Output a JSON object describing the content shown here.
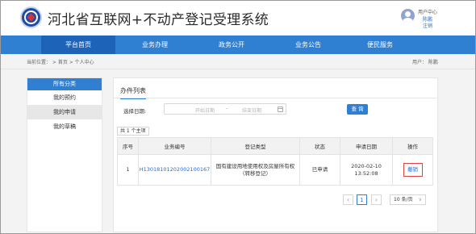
{
  "header": {
    "site_title": "河北省互联网+不动产登记受理系统",
    "user_center": "用户中心",
    "user_name": "陈鹏",
    "logout": "注销"
  },
  "nav": {
    "items": [
      {
        "label": "平台首页",
        "active": true
      },
      {
        "label": "业务办理"
      },
      {
        "label": "政务公开"
      },
      {
        "label": "业务公告"
      },
      {
        "label": "便民服务"
      }
    ]
  },
  "breadcrumb": {
    "text": "当前位置： >  首页  >  个人中心",
    "user_label": "用户： 陈鹏"
  },
  "sidebar": {
    "header": "所有分类",
    "items": [
      {
        "label": "我的预约"
      },
      {
        "label": "我的申请",
        "active": true
      },
      {
        "label": "我的草稿"
      }
    ]
  },
  "main": {
    "tab": "办件列表",
    "date_label": "选择日期:",
    "start_placeholder": "开始日期",
    "date_separator": "-",
    "end_placeholder": "结束日期",
    "query_label": "查 询",
    "total": "共 1 个主项",
    "table": {
      "headers": [
        "序号",
        "业务编号",
        "登记类型",
        "状态",
        "申请日期",
        "操作"
      ],
      "rows": [
        {
          "index": "1",
          "biz_no": "H13018101202002100167",
          "reg_type_line1": "国有建设用地使用权及房屋所有权",
          "reg_type_line2": "（转移登记）",
          "status": "已申请",
          "date_line1": "2020-02-10",
          "date_line2": "13:52:08",
          "action": "撤销"
        }
      ]
    },
    "pager": {
      "prev": "‹",
      "page": "1",
      "next": "›",
      "page_size": "10 条/页"
    }
  },
  "colors": {
    "nav_blue": "#2f7fd3",
    "active_nav": "#1d64b8",
    "link_blue": "#2a6bd6",
    "revoke_border": "#e0443e"
  }
}
